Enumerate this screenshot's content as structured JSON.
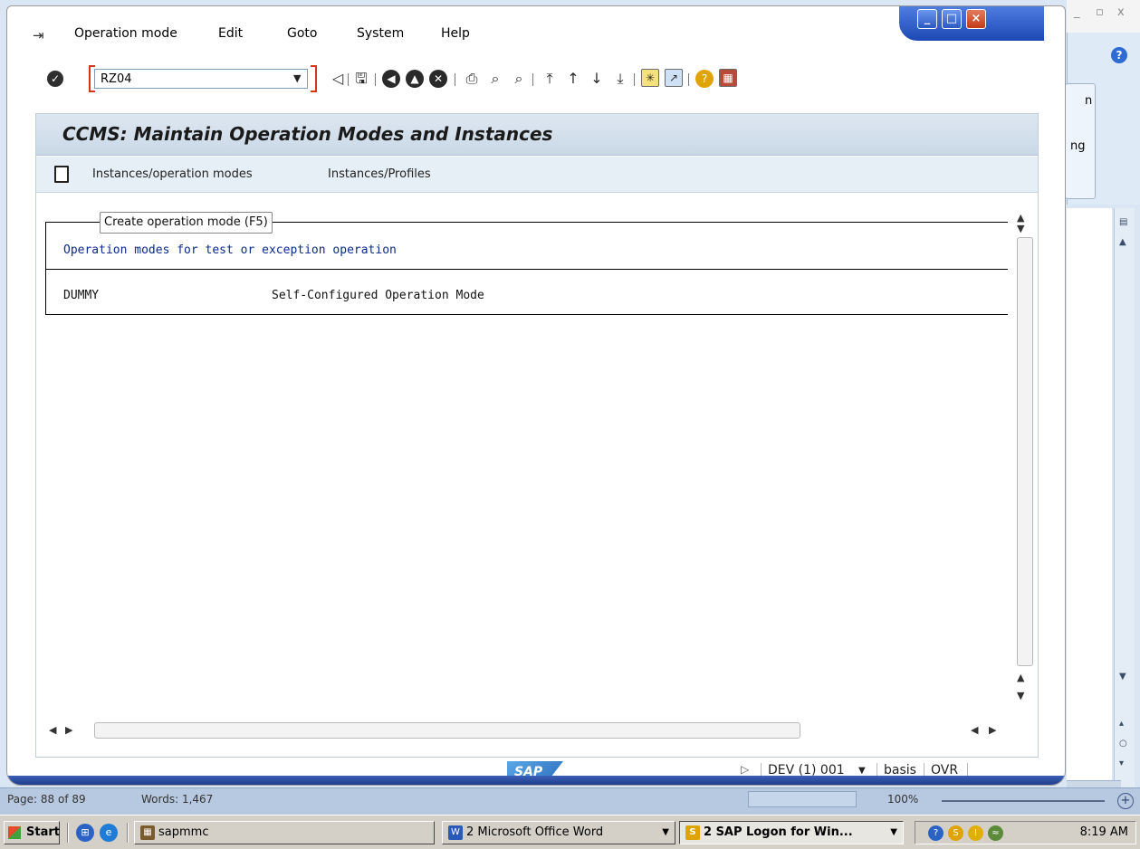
{
  "background_word": {
    "status_page": "Page: 88 of 89",
    "status_words": "Words: 1,467",
    "zoom": "100%",
    "ribbon_chars": [
      "n",
      "ng"
    ]
  },
  "sap": {
    "menu": [
      {
        "label": "Operation mode"
      },
      {
        "label": "Edit"
      },
      {
        "label": "Goto"
      },
      {
        "label": "System"
      },
      {
        "label": "Help"
      }
    ],
    "command_field": {
      "value": "RZ04"
    },
    "page_title": "CCMS: Maintain Operation Modes and Instances",
    "app_toolbar": {
      "instances_operation_modes": "Instances/operation modes",
      "instances_profiles": "Instances/Profiles"
    },
    "tooltip": "Create operation mode   (F5)",
    "section_header": "Operation modes for test or exception operation",
    "rows": [
      {
        "name": "DUMMY",
        "description": "Self-Configured Operation Mode"
      }
    ],
    "status": {
      "logo": "SAP",
      "system": "DEV (1) 001",
      "user": "basis",
      "mode": "OVR"
    }
  },
  "taskbar": {
    "start": "Start",
    "tasks": [
      {
        "label": "sapmmc"
      },
      {
        "label": "2 Microsoft Office Word"
      },
      {
        "label": "2 SAP Logon for Win..."
      }
    ],
    "clock": "8:19 AM"
  },
  "colors": {
    "title_bar_blue": "#1c49b5",
    "section_header": "#0a2a8c",
    "command_bracket": "#d2361b"
  }
}
